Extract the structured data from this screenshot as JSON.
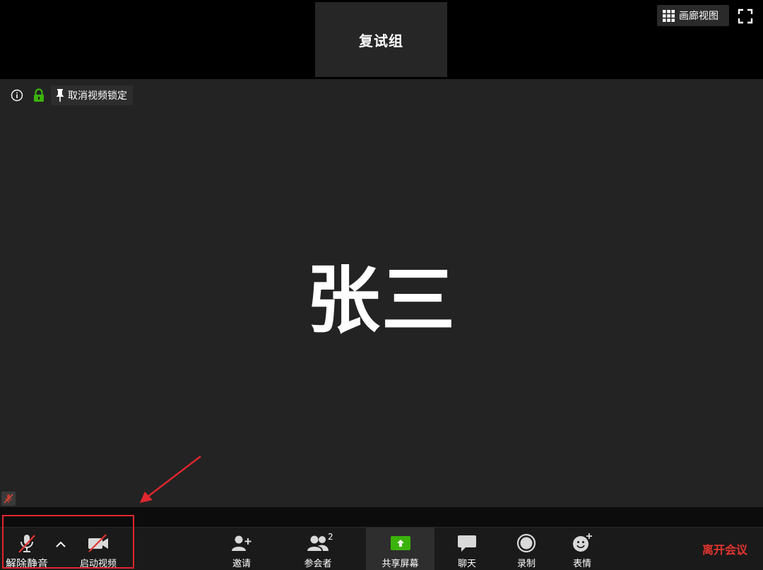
{
  "top": {
    "thumbnail_name": "复试组",
    "gallery_view_label": "画廊视图"
  },
  "main": {
    "unpin_label": "取消视频锁定",
    "participant_name": "张三"
  },
  "toolbar": {
    "unmute_label": "解除静音",
    "start_video_label": "启动视频",
    "invite_label": "邀请",
    "participants_label": "参会者",
    "participants_count": "2",
    "share_screen_label": "共享屏幕",
    "chat_label": "聊天",
    "record_label": "录制",
    "reactions_label": "表情",
    "leave_label": "离开会议"
  },
  "colors": {
    "accent_green": "#3bb30b",
    "leave_red": "#e3342f",
    "annotation_red": "#e0262e"
  }
}
